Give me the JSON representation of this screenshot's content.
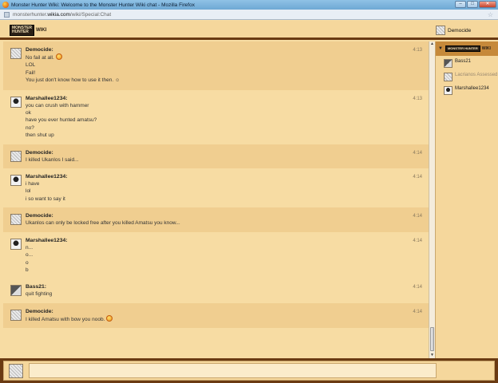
{
  "browser": {
    "window_title": "Monster Hunter Wiki: Welcome to the Monster Hunter Wiki chat - Mozilla Firefox",
    "url_prefix": "monsterhunter.",
    "url_domain": "wikia.com",
    "url_path": "/wiki/Special:Chat",
    "minimize": "–",
    "maximize": "□",
    "close": "✕"
  },
  "header": {
    "logo_text": "MONSTER HUNTER",
    "logo_wiki": "WIKI",
    "current_user": "Democide"
  },
  "messages": [
    {
      "user": "Democide:",
      "avatar": "checker",
      "time": "4:13",
      "shaded": true,
      "lines": [
        "No fail at all.",
        "LOL",
        "Fail!",
        "You just don't know how to use it then."
      ],
      "emoji_after": {
        "0": "smile",
        "3": "wink"
      }
    },
    {
      "user": "Marshallee1234:",
      "avatar": "dark",
      "time": "4:13",
      "shaded": false,
      "lines": [
        "you can crush with hammer",
        "ok",
        "have you ever hunted amatsu?",
        "no?",
        "then shut up"
      ]
    },
    {
      "user": "Democide:",
      "avatar": "checker",
      "time": "4:14",
      "shaded": true,
      "lines": [
        "I killed Ukanlos I said..."
      ]
    },
    {
      "user": "Marshallee1234:",
      "avatar": "dark",
      "time": "4:14",
      "shaded": false,
      "lines": [
        "i have",
        "lol",
        "i so want to say it"
      ]
    },
    {
      "user": "Democide:",
      "avatar": "checker",
      "time": "4:14",
      "shaded": true,
      "lines": [
        "Ukanlos can only be locked free after you killed Amatsu you know..."
      ]
    },
    {
      "user": "Marshallee1234:",
      "avatar": "dark",
      "time": "4:14",
      "shaded": false,
      "lines": [
        "n...",
        "o...",
        "o",
        "b"
      ]
    },
    {
      "user": "Bass21:",
      "avatar": "mono",
      "time": "4:14",
      "shaded": false,
      "lines": [
        "quit fighting"
      ]
    },
    {
      "user": "Democide:",
      "avatar": "checker",
      "time": "4:14",
      "shaded": true,
      "lines": [
        "I killed Amatsu with bow you noob."
      ],
      "emoji_after": {
        "0": "smile"
      }
    }
  ],
  "sidebar": {
    "users": [
      {
        "name": "Bass21",
        "avatar": "mono",
        "away": false
      },
      {
        "name": "Lacrianos Assessed",
        "avatar": "checker",
        "away": true
      },
      {
        "name": "Marshallee1234",
        "avatar": "dark",
        "away": false
      }
    ]
  },
  "input": {
    "placeholder": "",
    "value": ""
  },
  "icons": {
    "smile": "smile-emoji-icon",
    "wink": "wink-emoji-icon",
    "star": "bookmark-star-icon"
  }
}
